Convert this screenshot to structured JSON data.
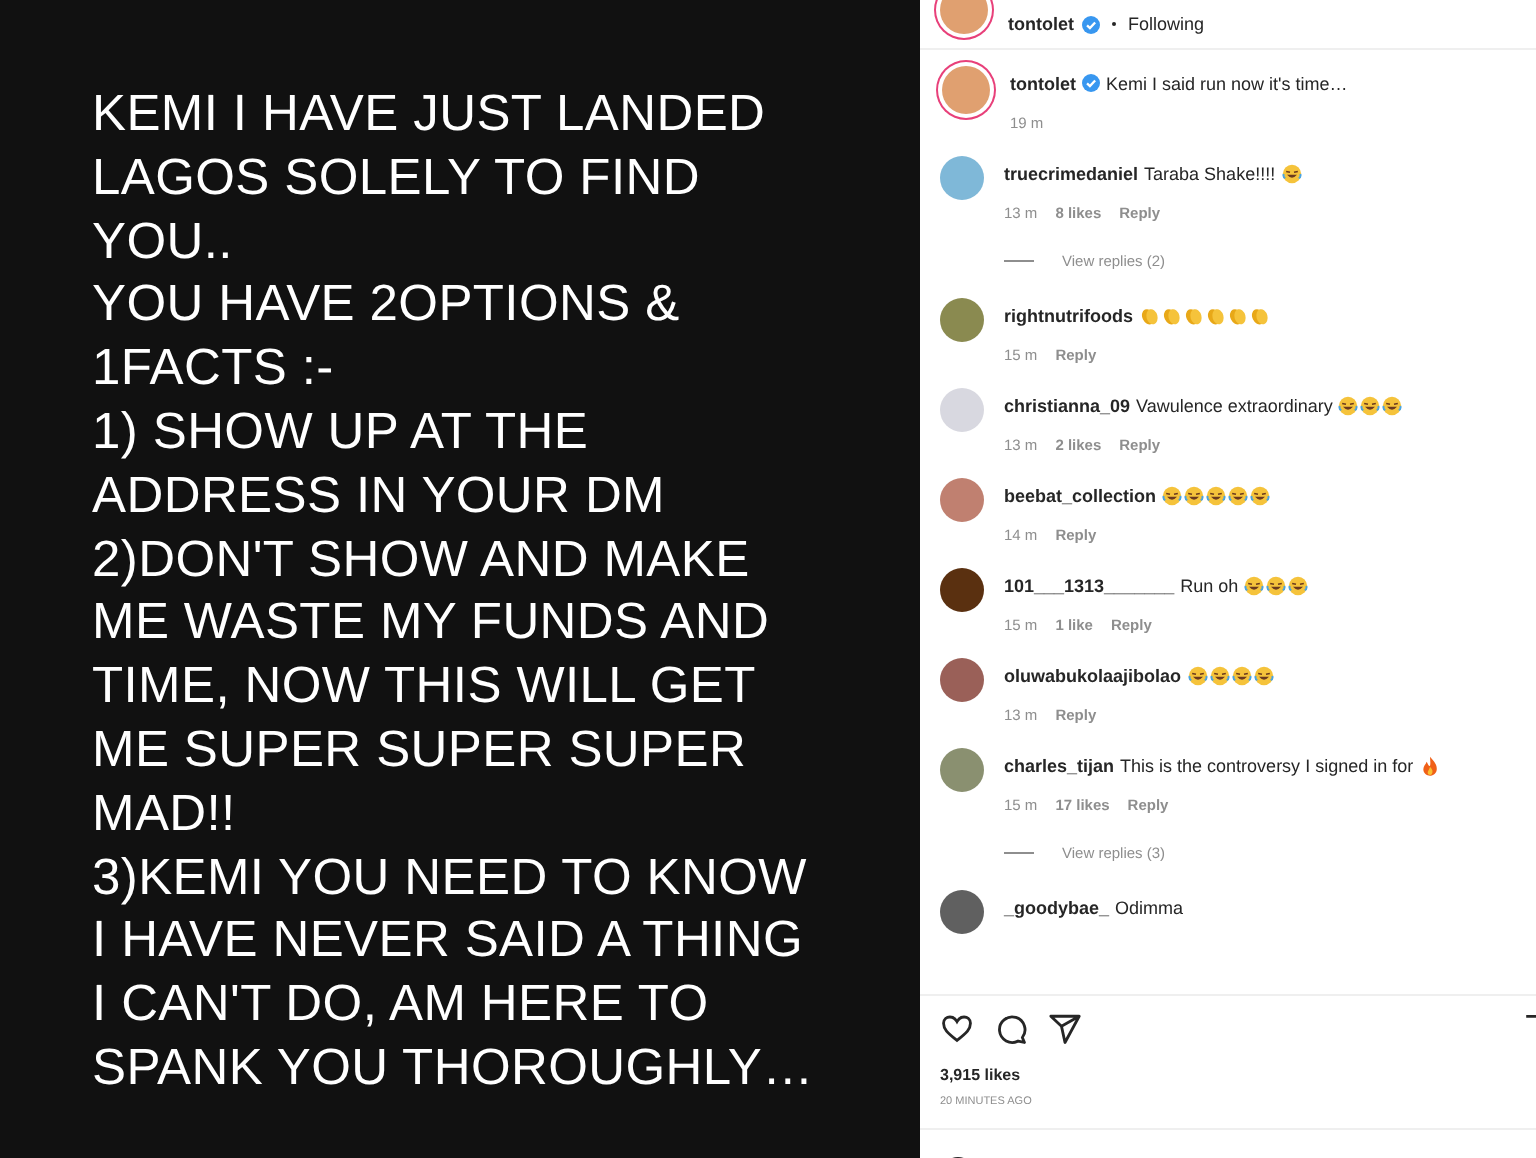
{
  "story": {
    "lines": [
      "KEMI I HAVE JUST LANDED",
      "LAGOS SOLELY TO FIND",
      "YOU..",
      "YOU HAVE 2OPTIONS &",
      "1FACTS :-",
      "1) SHOW UP AT THE",
      "ADDRESS IN YOUR DM",
      "2)DON'T SHOW AND MAKE",
      "ME WASTE MY FUNDS AND",
      "TIME, NOW THIS WILL GET",
      "ME SUPER SUPER SUPER",
      "MAD!!",
      "3)KEMI YOU NEED TO KNOW",
      "I HAVE NEVER SAID A THING",
      "I CAN'T DO, AM HERE TO",
      "SPANK YOU THOROUGHLY…"
    ]
  },
  "header": {
    "user": "tontolet",
    "verified": true,
    "follow": "Following"
  },
  "caption": {
    "user": "tontolet",
    "verified": true,
    "text": "Kemi I said run now it's time…",
    "time": "19 m"
  },
  "comments": [
    {
      "user": "truecrimedaniel",
      "text": "Taraba Shake!!!!",
      "emojis": [
        {
          "kind": "laugh"
        }
      ],
      "time": "13 m",
      "likes": "8 likes",
      "reply": "Reply",
      "replies": "View replies (2)",
      "color": "#7fb8d8"
    },
    {
      "user": "rightnutrifoods",
      "emojis": [
        {
          "kind": "clap"
        },
        {
          "kind": "clap"
        },
        {
          "kind": "clap"
        },
        {
          "kind": "clap"
        },
        {
          "kind": "clap"
        },
        {
          "kind": "clap"
        }
      ],
      "time": "15 m",
      "reply": "Reply",
      "color": "#8a8a50"
    },
    {
      "user": "christianna_09",
      "text": "Vawulence extraordinary",
      "emojis": [
        {
          "kind": "laugh"
        },
        {
          "kind": "laugh"
        },
        {
          "kind": "laugh"
        }
      ],
      "time": "13 m",
      "likes": "2 likes",
      "reply": "Reply",
      "color": "#d8d8e0"
    },
    {
      "user": "beebat_collection",
      "emojis": [
        {
          "kind": "laugh"
        },
        {
          "kind": "laugh"
        },
        {
          "kind": "laugh"
        },
        {
          "kind": "laugh"
        },
        {
          "kind": "laugh"
        }
      ],
      "time": "14 m",
      "reply": "Reply",
      "color": "#c08070"
    },
    {
      "user": "101___1313_______",
      "text": "Run oh",
      "emojis": [
        {
          "kind": "laugh"
        },
        {
          "kind": "laugh"
        },
        {
          "kind": "laugh"
        }
      ],
      "time": "15 m",
      "likes": "1 like",
      "reply": "Reply",
      "color": "#5a3010"
    },
    {
      "user": "oluwabukolaajibolao",
      "emojis": [
        {
          "kind": "laugh"
        },
        {
          "kind": "laugh"
        },
        {
          "kind": "laugh"
        },
        {
          "kind": "laugh"
        }
      ],
      "time": "13 m",
      "reply": "Reply",
      "color": "#9a6058"
    },
    {
      "user": "charles_tijan",
      "text": "This is the controversy I signed in for",
      "emojis": [
        {
          "kind": "fire"
        }
      ],
      "time": "15 m",
      "likes": "17 likes",
      "reply": "Reply",
      "replies": "View replies (3)",
      "color": "#8a9070"
    },
    {
      "user": "_goodybae_",
      "text": "Odimma",
      "color": "#606060"
    }
  ],
  "likes": "3,915 likes",
  "posted": "20 MINUTES AGO"
}
